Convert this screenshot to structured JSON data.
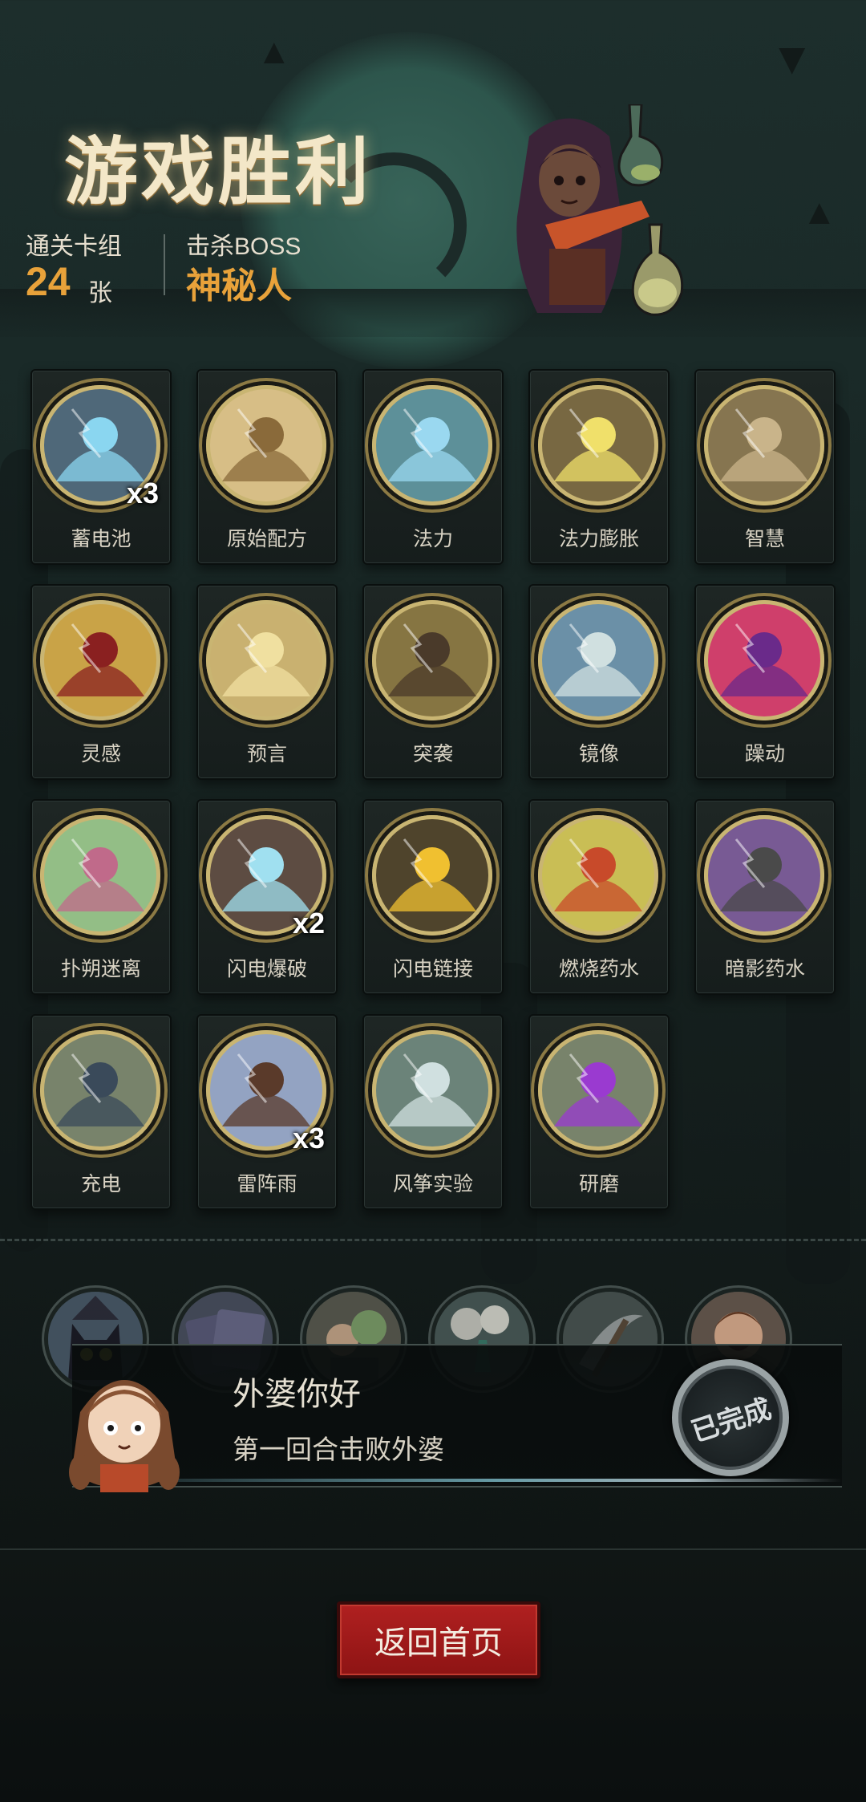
{
  "header": {
    "title": "游戏胜利",
    "cleared_deck_label": "通关卡组",
    "cleared_deck_count": "24",
    "cleared_deck_unit": "张",
    "boss_label": "击杀BOSS",
    "boss_name": "神秘人"
  },
  "cards": [
    {
      "name": "蓄电池",
      "badge": "x3",
      "icon": "battery-chest-icon"
    },
    {
      "name": "原始配方",
      "badge": "",
      "icon": "scroll-icon"
    },
    {
      "name": "法力",
      "badge": "",
      "icon": "mana-orb-icon"
    },
    {
      "name": "法力膨胀",
      "badge": "",
      "icon": "mana-surge-icon"
    },
    {
      "name": "智慧",
      "badge": "",
      "icon": "scholar-icon"
    },
    {
      "name": "灵感",
      "badge": "",
      "icon": "skull-inspiration-icon"
    },
    {
      "name": "预言",
      "badge": "",
      "icon": "prophet-icon"
    },
    {
      "name": "突袭",
      "badge": "",
      "icon": "raid-icon"
    },
    {
      "name": "镜像",
      "badge": "",
      "icon": "mirror-moon-icon"
    },
    {
      "name": "躁动",
      "badge": "",
      "icon": "frenzy-icon"
    },
    {
      "name": "扑朔迷离",
      "badge": "",
      "icon": "vortex-icon"
    },
    {
      "name": "闪电爆破",
      "badge": "x2",
      "icon": "lightning-burst-icon"
    },
    {
      "name": "闪电链接",
      "badge": "",
      "icon": "lightning-chain-icon"
    },
    {
      "name": "燃烧药水",
      "badge": "",
      "icon": "fire-potion-icon"
    },
    {
      "name": "暗影药水",
      "badge": "",
      "icon": "shadow-potion-icon"
    },
    {
      "name": "充电",
      "badge": "",
      "icon": "charge-icon"
    },
    {
      "name": "雷阵雨",
      "badge": "x3",
      "icon": "thunderstorm-icon"
    },
    {
      "name": "风筝实验",
      "badge": "",
      "icon": "kite-experiment-icon"
    },
    {
      "name": "研磨",
      "badge": "",
      "icon": "grind-icon"
    }
  ],
  "achievement": {
    "title": "外婆你好",
    "description": "第一回合击败外婆",
    "status": "已完成"
  },
  "actions": {
    "home_button": "返回首页"
  },
  "colors": {
    "accent_orange": "#e8a23a",
    "button_red": "#a01a1a",
    "medal_gold": "#c9b572"
  }
}
